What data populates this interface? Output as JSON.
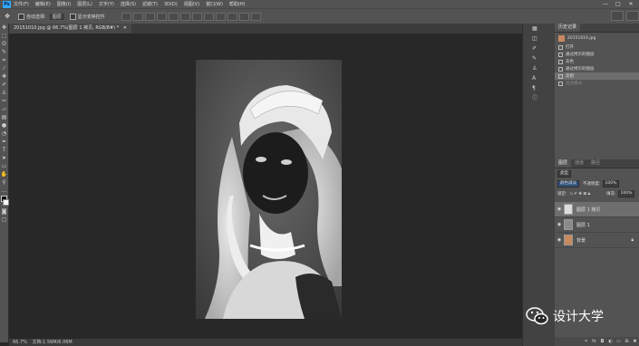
{
  "app": {
    "logo": "Ps"
  },
  "menu": [
    "文件(F)",
    "编辑(E)",
    "图像(I)",
    "图层(L)",
    "文字(Y)",
    "选择(S)",
    "滤镜(T)",
    "3D(D)",
    "视图(V)",
    "窗口(W)",
    "帮助(H)"
  ],
  "window_controls": [
    "—",
    "□",
    "✕"
  ],
  "options": {
    "auto_select": "自动选择:",
    "layer_select": "图层",
    "transform_controls": "显示变换控件"
  },
  "document": {
    "tab_label": "20151010.jpg @ 66.7%(图层 1 拷贝, RGB/8#) *",
    "zoom": "66.7%",
    "doc_info": "文档:1.56M/6.06M"
  },
  "history_panel": {
    "tabs": [
      "历史记录"
    ],
    "snapshot": "20151010.jpg",
    "items": [
      {
        "label": "打开",
        "state": "normal"
      },
      {
        "label": "通过拷贝的图层",
        "state": "normal"
      },
      {
        "label": "去色",
        "state": "normal"
      },
      {
        "label": "通过拷贝的图层",
        "state": "normal"
      },
      {
        "label": "反相",
        "state": "selected"
      },
      {
        "label": "混合模式",
        "state": "dim"
      }
    ]
  },
  "layers_panel": {
    "tabs": [
      "图层",
      "通道",
      "路径"
    ],
    "filter_label": "类型",
    "blend_mode": "颜色减淡",
    "opacity_label": "不透明度:",
    "opacity_value": "100%",
    "lock_label": "锁定:",
    "fill_label": "填充:",
    "fill_value": "100%",
    "layers": [
      {
        "name": "图层 1 拷贝",
        "selected": true
      },
      {
        "name": "图层 1",
        "selected": false
      },
      {
        "name": "背景",
        "selected": false,
        "locked": true
      }
    ]
  },
  "watermark": {
    "text": "设计大学"
  },
  "colors": {
    "accent": "#31a8ff",
    "panel": "#535353",
    "workspace": "#282828"
  }
}
